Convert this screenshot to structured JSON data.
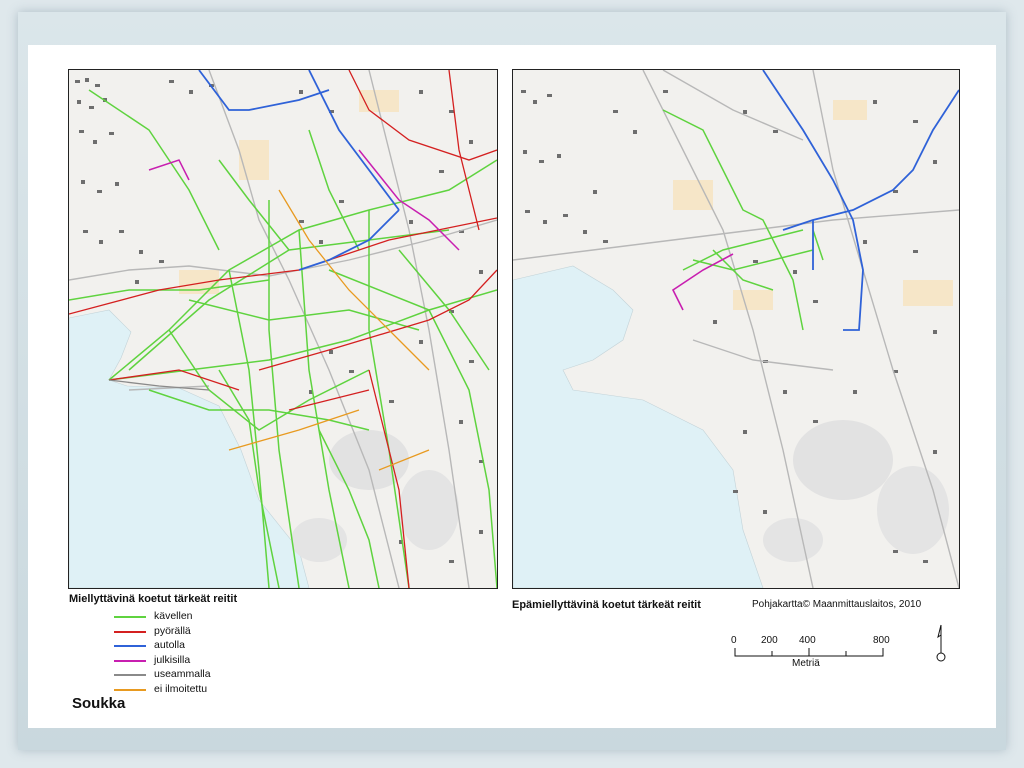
{
  "map_left": {
    "title": "Miellyttävinä koetut tärkeät reitit"
  },
  "map_right": {
    "title": "Epämiellyttävinä koetut tärkeät reitit"
  },
  "credit": "Pohjakartta© Maanmittauslaitos,  2010",
  "legend": {
    "items": [
      {
        "label": "kävellen",
        "color": "#5fd33f"
      },
      {
        "label": "pyörällä",
        "color": "#d42020"
      },
      {
        "label": "autolla",
        "color": "#2f62d8"
      },
      {
        "label": "julkisilla",
        "color": "#c81fb0"
      },
      {
        "label": "useammalla",
        "color": "#8a8a8a"
      },
      {
        "label": "ei ilmoitettu",
        "color": "#e89a20"
      }
    ]
  },
  "place_name": "Soukka",
  "scale": {
    "ticks": [
      "0",
      "200",
      "400",
      "800"
    ],
    "unit": "Metriä"
  },
  "colors": {
    "land": "#f2f1ee",
    "water": "#dff1f6",
    "buildings": "#6e6e6e",
    "fields": "#f6e6c8"
  },
  "icons": {
    "north_arrow": "north-arrow-icon"
  }
}
